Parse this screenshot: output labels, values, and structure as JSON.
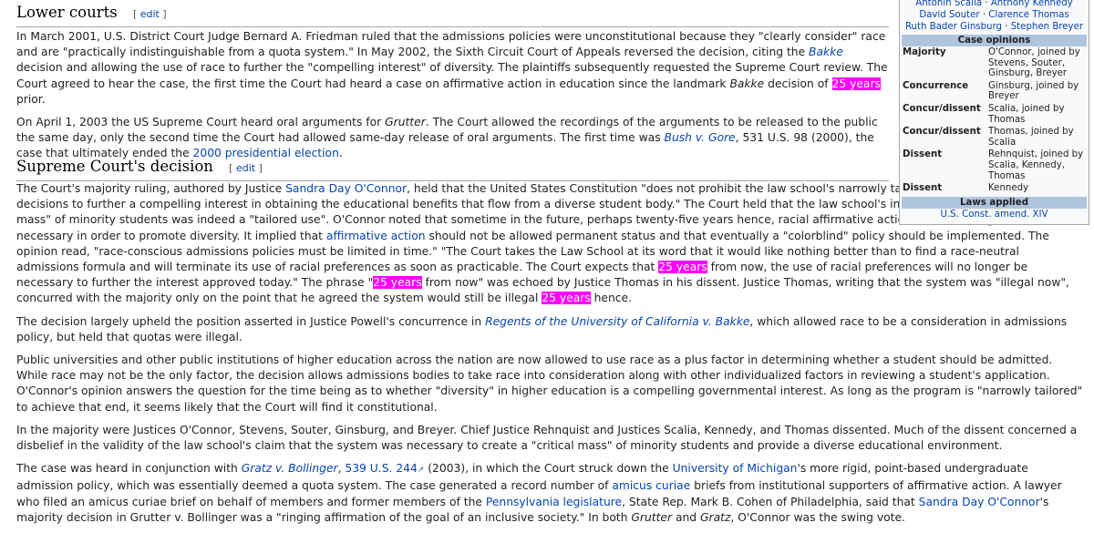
{
  "section_lower": {
    "title": "Lower courts",
    "edit": "edit",
    "p1": [
      {
        "t": "In March 2001, U.S. District Court Judge Bernard A. Friedman ruled that the admissions policies were unconstitutional because they \"clearly consider\" race and are \"practically indistinguishable from a quota system.\" In May 2002, the Sixth Circuit Court of Appeals reversed the decision, citing the "
      },
      {
        "t": "Bakke",
        "k": "link-i"
      },
      {
        "t": " decision and allowing the use of race to further the \"compelling interest\" of diversity. The plaintiffs subsequently requested the Supreme Court review. The Court agreed to hear the case, the first time the Court had heard a case on affirmative action in education since the landmark "
      },
      {
        "t": "Bakke",
        "k": "i"
      },
      {
        "t": " decision of "
      },
      {
        "t": "25 years",
        "k": "hl"
      },
      {
        "t": " prior."
      }
    ],
    "p2": [
      {
        "t": "On April 1, 2003 the US Supreme Court heard oral arguments for "
      },
      {
        "t": "Grutter",
        "k": "i"
      },
      {
        "t": ". The Court allowed the recordings of the arguments to be released to the public the same day, only the second time the Court had allowed same-day release of oral arguments. The first time was "
      },
      {
        "t": "Bush v. Gore",
        "k": "link-i"
      },
      {
        "t": ", 531 U.S. 98 (2000), the case that ultimately ended the "
      },
      {
        "t": "2000 presidential election",
        "k": "link"
      },
      {
        "t": "."
      }
    ]
  },
  "section_supreme": {
    "title": "Supreme Court's decision",
    "edit": "edit",
    "p1": [
      {
        "t": "The Court's majority ruling, authored by Justice "
      },
      {
        "t": "Sandra Day O'Connor",
        "k": "link"
      },
      {
        "t": ", held that the United States Constitution \"does not prohibit the law school's narrowly tailored use of race in admissions decisions to further a compelling interest in obtaining the educational benefits that flow from a diverse student body.\" The Court held that the law school's interest in obtaining a \"critical mass\" of minority students was indeed a \"tailored use\". O'Connor noted that sometime in the future, perhaps twenty-five years hence, racial affirmative action would no longer be necessary in order to promote diversity. It implied that "
      },
      {
        "t": "affirmative action",
        "k": "link"
      },
      {
        "t": " should not be allowed permanent status and that eventually a \"colorblind\" policy should be implemented. The opinion read, \"race-conscious admissions policies must be limited in time.\" \"The Court takes the Law School at its word that it would like nothing better than to find a race-neutral admissions formula and will terminate its use of racial preferences as soon as practicable. The Court expects that "
      },
      {
        "t": "25 years",
        "k": "hl"
      },
      {
        "t": " from now, the use of racial preferences will no longer be necessary to further the interest approved today.\" The phrase \""
      },
      {
        "t": "25 years",
        "k": "hl"
      },
      {
        "t": " from now\" was echoed by Justice Thomas in his dissent. Justice Thomas, writing that the system was \"illegal now\", concurred with the majority only on the point that he agreed the system would still be illegal "
      },
      {
        "t": "25 years",
        "k": "hl"
      },
      {
        "t": " hence."
      }
    ],
    "p2": [
      {
        "t": "The decision largely upheld the position asserted in Justice Powell's concurrence in "
      },
      {
        "t": "Regents of the University of California v. Bakke",
        "k": "link-i"
      },
      {
        "t": ", which allowed race to be a consideration in admissions policy, but held that quotas were illegal."
      }
    ],
    "p3": [
      {
        "t": "Public universities and other public institutions of higher education across the nation are now allowed to use race as a plus factor in determining whether a student should be admitted. While race may not be the only factor, the decision allows admissions bodies to take race into consideration along with other individualized factors in reviewing a student's application. O'Connor's opinion answers the question for the time being as to whether \"diversity\" in higher education is a compelling governmental interest. As long as the program is \"narrowly tailored\" to achieve that end, it seems likely that the Court will find it constitutional."
      }
    ],
    "p4": [
      {
        "t": "In the majority were Justices O'Connor, Stevens, Souter, Ginsburg, and Breyer. Chief Justice Rehnquist and Justices Scalia, Kennedy, and Thomas dissented. Much of the dissent concerned a disbelief in the validity of the law school's claim that the system was necessary to create a \"critical mass\" of minority students and provide a diverse educational environment."
      }
    ],
    "p5": [
      {
        "t": "The case was heard in conjunction with "
      },
      {
        "t": "Gratz v. Bollinger",
        "k": "link-i"
      },
      {
        "t": ", "
      },
      {
        "t": "539 U.S. 244",
        "k": "link"
      },
      {
        "t": "↗",
        "k": "ext"
      },
      {
        "t": " (2003), in which the Court struck down the "
      },
      {
        "t": "University of Michigan",
        "k": "link"
      },
      {
        "t": "'s more rigid, point-based undergraduate admission policy, which was essentially deemed a quota system. The case generated a record number of "
      },
      {
        "t": "amicus curiae",
        "k": "link"
      },
      {
        "t": " briefs from institutional supporters of affirmative action. A lawyer who filed an amicus curiae brief on behalf of members and former members of the "
      },
      {
        "t": "Pennsylvania legislature",
        "k": "link"
      },
      {
        "t": ", State Rep. Mark B. Cohen of Philadelphia, said that "
      },
      {
        "t": "Sandra Day O'Connor",
        "k": "link"
      },
      {
        "t": "'s majority decision in Grutter v. Bollinger was a \"ringing affirmation of the goal of an inclusive society.\" In both "
      },
      {
        "t": "Grutter",
        "k": "i"
      },
      {
        "t": " and "
      },
      {
        "t": "Gratz",
        "k": "i"
      },
      {
        "t": ", O'Connor was the swing vote."
      }
    ]
  },
  "infobox": {
    "justices": [
      [
        "Antonin Scalia",
        "Anthony Kennedy"
      ],
      [
        "David Souter",
        "Clarence Thomas"
      ],
      [
        "Ruth Bader Ginsburg",
        "Stephen Breyer"
      ]
    ],
    "separator": " · ",
    "opinions_header": "Case opinions",
    "opinions": [
      {
        "k": "Majority",
        "v": "O'Connor, joined by Stevens, Souter, Ginsburg, Breyer"
      },
      {
        "k": "Concurrence",
        "v": "Ginsburg, joined by Breyer"
      },
      {
        "k": "Concur/dissent",
        "v": "Scalia, joined by Thomas"
      },
      {
        "k": "Concur/dissent",
        "v": "Thomas, joined by Scalia"
      },
      {
        "k": "Dissent",
        "v": "Rehnquist, joined by Scalia, Kennedy, Thomas"
      },
      {
        "k": "Dissent",
        "v": "Kennedy"
      }
    ],
    "laws_header": "Laws applied",
    "law": "U.S. Const. amend. XIV"
  },
  "colors": {
    "link": "#0645ad",
    "highlight": "#ff00ff",
    "section_header": "#b0c4de"
  }
}
